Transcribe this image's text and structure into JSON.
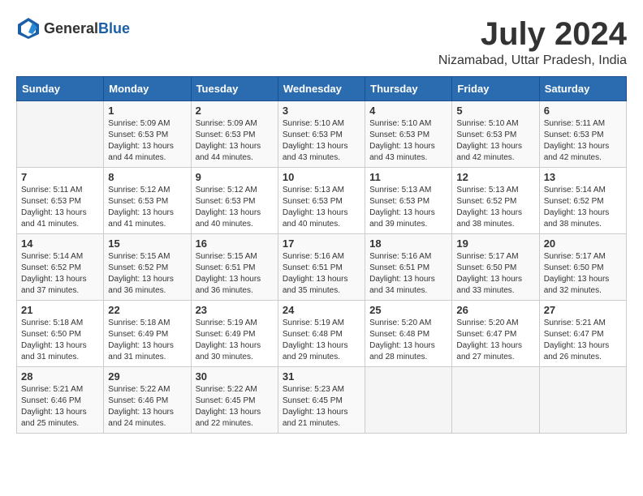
{
  "header": {
    "logo_general": "General",
    "logo_blue": "Blue",
    "month_year": "July 2024",
    "location": "Nizamabad, Uttar Pradesh, India"
  },
  "calendar": {
    "days_of_week": [
      "Sunday",
      "Monday",
      "Tuesday",
      "Wednesday",
      "Thursday",
      "Friday",
      "Saturday"
    ],
    "weeks": [
      [
        {
          "day": "",
          "info": ""
        },
        {
          "day": "1",
          "info": "Sunrise: 5:09 AM\nSunset: 6:53 PM\nDaylight: 13 hours\nand 44 minutes."
        },
        {
          "day": "2",
          "info": "Sunrise: 5:09 AM\nSunset: 6:53 PM\nDaylight: 13 hours\nand 44 minutes."
        },
        {
          "day": "3",
          "info": "Sunrise: 5:10 AM\nSunset: 6:53 PM\nDaylight: 13 hours\nand 43 minutes."
        },
        {
          "day": "4",
          "info": "Sunrise: 5:10 AM\nSunset: 6:53 PM\nDaylight: 13 hours\nand 43 minutes."
        },
        {
          "day": "5",
          "info": "Sunrise: 5:10 AM\nSunset: 6:53 PM\nDaylight: 13 hours\nand 42 minutes."
        },
        {
          "day": "6",
          "info": "Sunrise: 5:11 AM\nSunset: 6:53 PM\nDaylight: 13 hours\nand 42 minutes."
        }
      ],
      [
        {
          "day": "7",
          "info": "Sunrise: 5:11 AM\nSunset: 6:53 PM\nDaylight: 13 hours\nand 41 minutes."
        },
        {
          "day": "8",
          "info": "Sunrise: 5:12 AM\nSunset: 6:53 PM\nDaylight: 13 hours\nand 41 minutes."
        },
        {
          "day": "9",
          "info": "Sunrise: 5:12 AM\nSunset: 6:53 PM\nDaylight: 13 hours\nand 40 minutes."
        },
        {
          "day": "10",
          "info": "Sunrise: 5:13 AM\nSunset: 6:53 PM\nDaylight: 13 hours\nand 40 minutes."
        },
        {
          "day": "11",
          "info": "Sunrise: 5:13 AM\nSunset: 6:53 PM\nDaylight: 13 hours\nand 39 minutes."
        },
        {
          "day": "12",
          "info": "Sunrise: 5:13 AM\nSunset: 6:52 PM\nDaylight: 13 hours\nand 38 minutes."
        },
        {
          "day": "13",
          "info": "Sunrise: 5:14 AM\nSunset: 6:52 PM\nDaylight: 13 hours\nand 38 minutes."
        }
      ],
      [
        {
          "day": "14",
          "info": "Sunrise: 5:14 AM\nSunset: 6:52 PM\nDaylight: 13 hours\nand 37 minutes."
        },
        {
          "day": "15",
          "info": "Sunrise: 5:15 AM\nSunset: 6:52 PM\nDaylight: 13 hours\nand 36 minutes."
        },
        {
          "day": "16",
          "info": "Sunrise: 5:15 AM\nSunset: 6:51 PM\nDaylight: 13 hours\nand 36 minutes."
        },
        {
          "day": "17",
          "info": "Sunrise: 5:16 AM\nSunset: 6:51 PM\nDaylight: 13 hours\nand 35 minutes."
        },
        {
          "day": "18",
          "info": "Sunrise: 5:16 AM\nSunset: 6:51 PM\nDaylight: 13 hours\nand 34 minutes."
        },
        {
          "day": "19",
          "info": "Sunrise: 5:17 AM\nSunset: 6:50 PM\nDaylight: 13 hours\nand 33 minutes."
        },
        {
          "day": "20",
          "info": "Sunrise: 5:17 AM\nSunset: 6:50 PM\nDaylight: 13 hours\nand 32 minutes."
        }
      ],
      [
        {
          "day": "21",
          "info": "Sunrise: 5:18 AM\nSunset: 6:50 PM\nDaylight: 13 hours\nand 31 minutes."
        },
        {
          "day": "22",
          "info": "Sunrise: 5:18 AM\nSunset: 6:49 PM\nDaylight: 13 hours\nand 31 minutes."
        },
        {
          "day": "23",
          "info": "Sunrise: 5:19 AM\nSunset: 6:49 PM\nDaylight: 13 hours\nand 30 minutes."
        },
        {
          "day": "24",
          "info": "Sunrise: 5:19 AM\nSunset: 6:48 PM\nDaylight: 13 hours\nand 29 minutes."
        },
        {
          "day": "25",
          "info": "Sunrise: 5:20 AM\nSunset: 6:48 PM\nDaylight: 13 hours\nand 28 minutes."
        },
        {
          "day": "26",
          "info": "Sunrise: 5:20 AM\nSunset: 6:47 PM\nDaylight: 13 hours\nand 27 minutes."
        },
        {
          "day": "27",
          "info": "Sunrise: 5:21 AM\nSunset: 6:47 PM\nDaylight: 13 hours\nand 26 minutes."
        }
      ],
      [
        {
          "day": "28",
          "info": "Sunrise: 5:21 AM\nSunset: 6:46 PM\nDaylight: 13 hours\nand 25 minutes."
        },
        {
          "day": "29",
          "info": "Sunrise: 5:22 AM\nSunset: 6:46 PM\nDaylight: 13 hours\nand 24 minutes."
        },
        {
          "day": "30",
          "info": "Sunrise: 5:22 AM\nSunset: 6:45 PM\nDaylight: 13 hours\nand 22 minutes."
        },
        {
          "day": "31",
          "info": "Sunrise: 5:23 AM\nSunset: 6:45 PM\nDaylight: 13 hours\nand 21 minutes."
        },
        {
          "day": "",
          "info": ""
        },
        {
          "day": "",
          "info": ""
        },
        {
          "day": "",
          "info": ""
        }
      ]
    ]
  }
}
